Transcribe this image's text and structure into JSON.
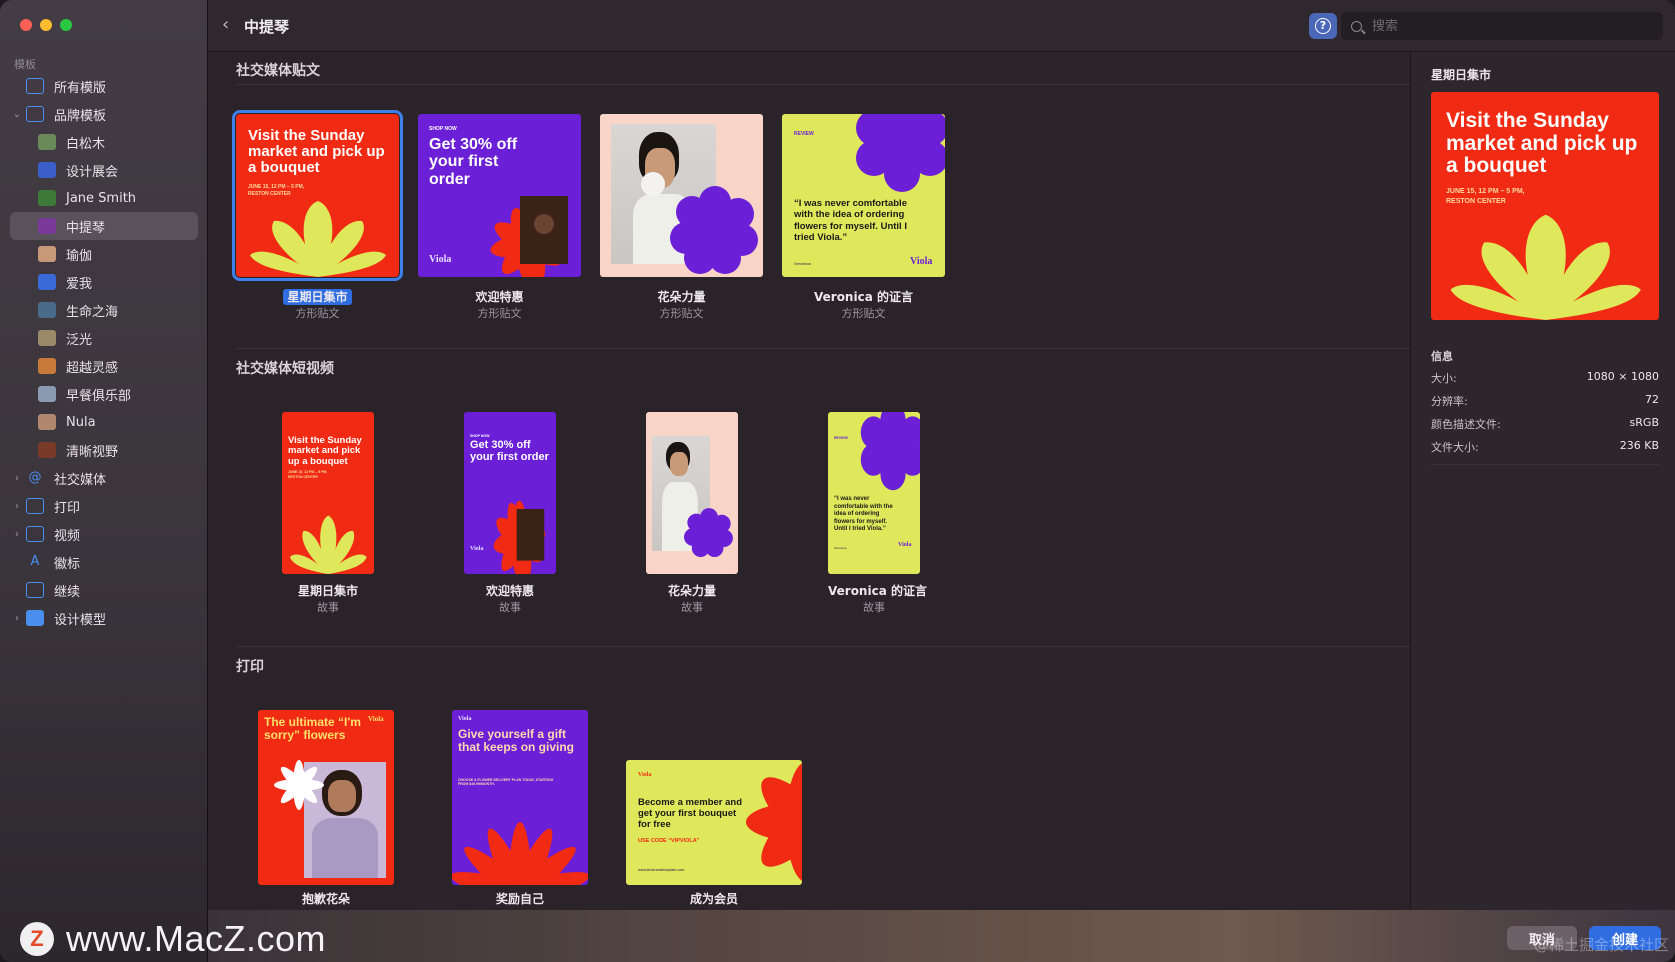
{
  "window": {
    "title": "中提琴"
  },
  "sidebar": {
    "header": "模板",
    "items": [
      {
        "label": "所有模版",
        "level": 1,
        "icon": "grid-icon"
      },
      {
        "label": "品牌模板",
        "level": 1,
        "icon": "brand-icon",
        "expanded": true
      },
      {
        "label": "白松木",
        "level": 2,
        "icon": "thumb-icon"
      },
      {
        "label": "设计展会",
        "level": 2,
        "icon": "thumb-icon"
      },
      {
        "label": "Jane Smith",
        "level": 2,
        "icon": "thumb-icon"
      },
      {
        "label": "中提琴",
        "level": 2,
        "icon": "thumb-icon",
        "selected": true
      },
      {
        "label": "瑜伽",
        "level": 2,
        "icon": "thumb-icon"
      },
      {
        "label": "爱我",
        "level": 2,
        "icon": "thumb-icon"
      },
      {
        "label": "生命之海",
        "level": 2,
        "icon": "thumb-icon"
      },
      {
        "label": "泛光",
        "level": 2,
        "icon": "thumb-icon"
      },
      {
        "label": "超越灵感",
        "level": 2,
        "icon": "thumb-icon"
      },
      {
        "label": "早餐俱乐部",
        "level": 2,
        "icon": "thumb-icon"
      },
      {
        "label": "Nula",
        "level": 2,
        "icon": "thumb-icon"
      },
      {
        "label": "清晰视野",
        "level": 2,
        "icon": "thumb-icon"
      },
      {
        "label": "社交媒体",
        "level": 1,
        "icon": "at-icon",
        "collapsible": true
      },
      {
        "label": "打印",
        "level": 1,
        "icon": "print-icon",
        "collapsible": true
      },
      {
        "label": "视频",
        "level": 1,
        "icon": "video-icon",
        "collapsible": true
      },
      {
        "label": "徽标",
        "level": 1,
        "icon": "logo-a-icon"
      },
      {
        "label": "继续",
        "level": 1,
        "icon": "doc-icon"
      },
      {
        "label": "设计模型",
        "level": 1,
        "icon": "mockup-icon",
        "collapsible": true
      }
    ]
  },
  "toolbar": {
    "back": "‹",
    "title": "中提琴",
    "help": "?",
    "search_placeholder": "搜索"
  },
  "sections": {
    "social_posts": {
      "title": "社交媒体贴文",
      "cards": [
        {
          "label": "星期日集市",
          "sub": "方形贴文",
          "selected": true
        },
        {
          "label": "欢迎特惠",
          "sub": "方形贴文"
        },
        {
          "label": "花朵力量",
          "sub": "方形贴文"
        },
        {
          "label": "Veronica 的证言",
          "sub": "方形贴文"
        }
      ]
    },
    "social_stories": {
      "title": "社交媒体短视频",
      "cards": [
        {
          "label": "星期日集市",
          "sub": "故事"
        },
        {
          "label": "欢迎特惠",
          "sub": "故事"
        },
        {
          "label": "花朵力量",
          "sub": "故事"
        },
        {
          "label": "Veronica 的证言",
          "sub": "故事"
        }
      ]
    },
    "print": {
      "title": "打印",
      "cards": [
        {
          "label": "抱歉花朵"
        },
        {
          "label": "奖励自己"
        },
        {
          "label": "成为会员"
        }
      ]
    }
  },
  "templates": {
    "sunday": {
      "headline": "Visit the Sunday market and pick up a bouquet",
      "date": "JUNE 15, 12 PM – 5 PM,",
      "place": "RESTON CENTER"
    },
    "welcome": {
      "kicker": "SHOP NOW",
      "headline": "Get 30% off your first order",
      "brand": "Viola"
    },
    "veronica": {
      "kicker": "REVIEW",
      "quote": "“I was never comfortable with the idea of ordering flowers for myself. Until I tried Viola.”",
      "name": "Veronica",
      "brand": "Viola"
    },
    "sorry": {
      "headline": "The ultimate “I'm sorry” flowers",
      "brand": "Viola"
    },
    "gift": {
      "brand": "Viola",
      "headline": "Give yourself a gift that keeps on giving",
      "small": "CHOOSE A FLOWER DELIVERY PLAN TODAY, STARTING FROM $49.99/MONTH."
    },
    "member": {
      "brand": "Viola",
      "headline": "Become a member and get your first bouquet for free",
      "code": "USE CODE “VIPVIOLA”",
      "url": "www.thebrandtemplate.com"
    }
  },
  "inspector": {
    "title": "星期日集市",
    "info_header": "信息",
    "rows": [
      {
        "k": "大小:",
        "v": "1080 × 1080"
      },
      {
        "k": "分辨率:",
        "v": "72"
      },
      {
        "k": "颜色描述文件:",
        "v": "sRGB"
      },
      {
        "k": "文件大小:",
        "v": "236 KB"
      }
    ]
  },
  "footer": {
    "cancel": "取消",
    "create": "创建",
    "watermark": "@稀土掘金技术社区"
  },
  "brand_overlay": {
    "logo": "Z",
    "text": "www.MacZ.com"
  },
  "colors": {
    "accent": "#2f6de0",
    "red": "#f02a13",
    "purple": "#6b1fd6",
    "lime": "#dfe85a",
    "peach": "#f8d5c7"
  }
}
